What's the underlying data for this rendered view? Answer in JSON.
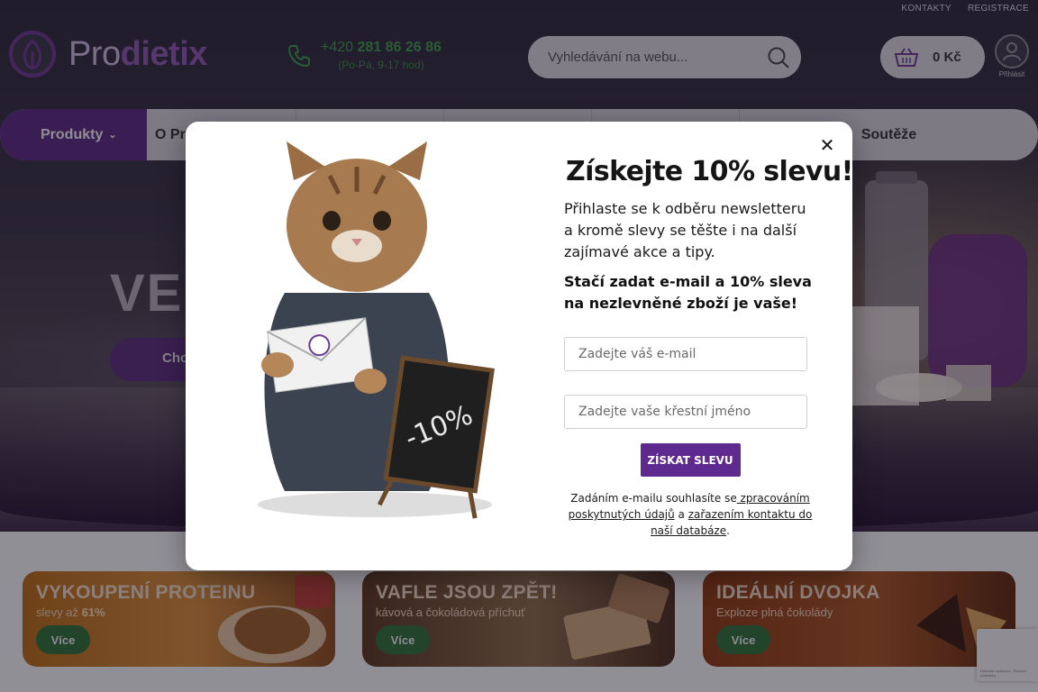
{
  "header": {
    "top_links": [
      "KONTAKTY",
      "REGISTRACE"
    ],
    "logo": {
      "prefix": "Pro",
      "suffix": "dietix"
    },
    "phone": {
      "prefix": "+420",
      "number": "281 86 26 86",
      "hours": "(Po-Pá, 9-17 hod)"
    },
    "search": {
      "placeholder": "Vyhledávání na webu..."
    },
    "cart": {
      "total": "0 Kč"
    },
    "account": {
      "label": "Přihlásit"
    }
  },
  "nav": {
    "products": "Produkty",
    "about_partial": "O Pr",
    "contests": "Soutěže"
  },
  "hero": {
    "headline_partial": "VEL",
    "cta_partial": "Cho"
  },
  "promos": [
    {
      "title": "VYKOUPENÍ PROTEINU",
      "sub_text": "slevy až",
      "sub_bold": "61%",
      "button": "Více"
    },
    {
      "title": "VAFLE JSOU ZPĚT!",
      "sub_text": "kávová a čokoládová příchuť",
      "sub_bold": "",
      "button": "Více"
    },
    {
      "title": "IDEÁLNÍ DVOJKA",
      "sub_text": "Exploze plná čokolády",
      "sub_bold": "",
      "button": "Více"
    }
  ],
  "recaptcha": {
    "text": "Ochrana soukromí - Smluvní podmínky"
  },
  "modal": {
    "close": "✕",
    "title": "Získejte 10% slevu!",
    "text": "Přihlaste se k odběru newsletteru a kromě slevy se těšte i na další zajímavé akce a tipy.",
    "strong": "Stačí zadat e-mail a 10% sleva na nezlevněné zboží je vaše!",
    "email_placeholder": "Zadejte váš e-mail",
    "name_placeholder": "Zadejte vaše křestní jméno",
    "submit": "ZÍSKAT SLEVU",
    "consent": {
      "pre": "Zadáním e-mailu souhlasíte se",
      "link1": " zpracováním poskytnutých údajů",
      "mid": " a ",
      "link2": "zařazením kontaktu do naší databáze",
      "post": "."
    },
    "sign_text": "-10%"
  },
  "colors": {
    "brand_purple": "#5f2a8f",
    "phone_green": "#3f9a4b",
    "promo_button_green": "#2f6f3a"
  }
}
